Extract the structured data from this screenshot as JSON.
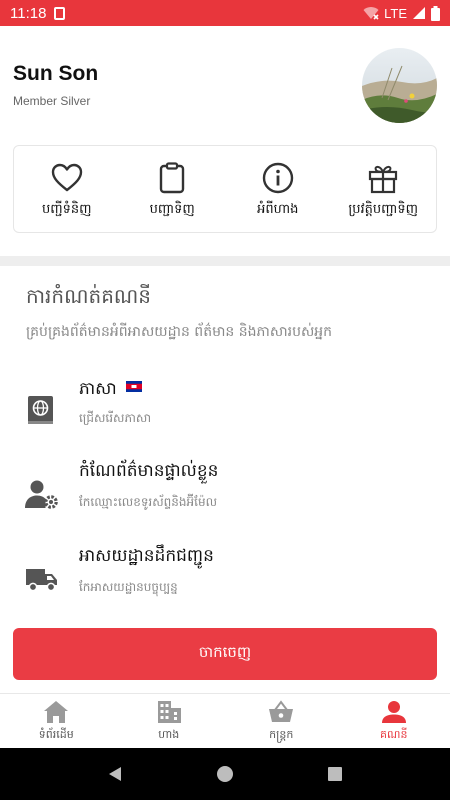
{
  "status_bar": {
    "time": "11:18",
    "network": "LTE",
    "icons": [
      "sd-card-icon",
      "wifi-off-icon",
      "signal-icon",
      "battery-icon"
    ]
  },
  "profile": {
    "name": "Sun Son",
    "tier": "Member Silver",
    "avatar_icon": "avatar-photo"
  },
  "quick_actions": [
    {
      "label": "បញ្ជីទំនិញ",
      "icon": "heart-icon"
    },
    {
      "label": "បញ្ជាទិញ",
      "icon": "clipboard-icon"
    },
    {
      "label": "អំពីហាង",
      "icon": "info-icon"
    },
    {
      "label": "ប្រវត្តិបញ្ជាទិញ",
      "icon": "gift-icon"
    }
  ],
  "settings": {
    "title": "ការកំណត់គណនី",
    "subtitle": "គ្រប់គ្រងព័ត៌មានអំពីអាសយដ្ឋាន ព័ត៌មាន និងភាសារបស់អ្នក",
    "rows": [
      {
        "title": "ភាសា",
        "subtitle": "ជ្រើសរើសភាសា",
        "icon": "language-book-icon",
        "flag_icon": "cambodia-flag-icon"
      },
      {
        "title": "កំណែព័ត៌មានផ្ទាល់ខ្លួន",
        "subtitle": "កែឈ្មោះលេខទូរស័ព្ទនិងអ៊ីម៉ែល",
        "icon": "user-settings-icon"
      },
      {
        "title": "អាសយដ្ឋានដឹកជញ្ជូន",
        "subtitle": "កែអាសយដ្ឋានបច្ចុប្បន្ន",
        "icon": "delivery-truck-icon"
      }
    ]
  },
  "logout_label": "ចាកចេញ",
  "bottom_nav": [
    {
      "label": "ទំព័រដើម",
      "icon": "home-icon",
      "active": false
    },
    {
      "label": "ហាង",
      "icon": "store-icon",
      "active": false
    },
    {
      "label": "កន្ត្រក",
      "icon": "basket-icon",
      "active": false
    },
    {
      "label": "គណនី",
      "icon": "account-icon",
      "active": true
    }
  ],
  "colors": {
    "accent": "#e8363c",
    "button": "#ea3c44",
    "icon": "#333333",
    "inactive_nav": "#9a9a9a"
  }
}
